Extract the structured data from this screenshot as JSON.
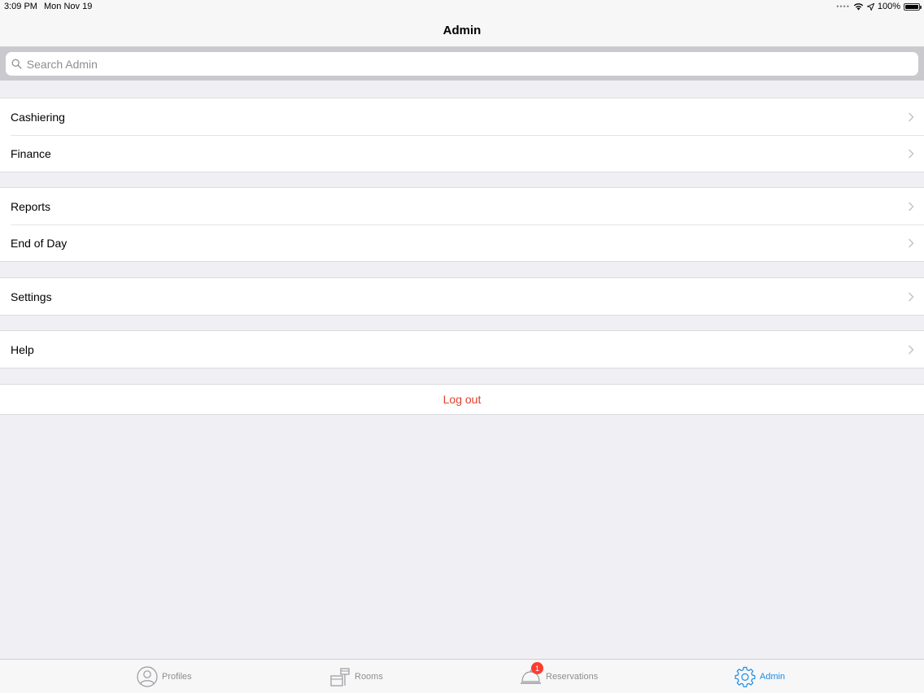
{
  "status_bar": {
    "time": "3:09 PM",
    "date": "Mon Nov 19",
    "battery_text": "100%",
    "icons": [
      "cellular-dots-icon",
      "wifi-icon",
      "location-arrow-icon",
      "battery-icon"
    ]
  },
  "nav": {
    "title": "Admin"
  },
  "search": {
    "placeholder": "Search Admin",
    "value": ""
  },
  "groups": [
    {
      "items": [
        {
          "label": "Cashiering"
        },
        {
          "label": "Finance"
        }
      ]
    },
    {
      "items": [
        {
          "label": "Reports"
        },
        {
          "label": "End of Day"
        }
      ]
    },
    {
      "items": [
        {
          "label": "Settings"
        }
      ]
    },
    {
      "items": [
        {
          "label": "Help"
        }
      ]
    }
  ],
  "logout": {
    "label": "Log out",
    "color": "#e1402a"
  },
  "tabbar": {
    "active_color": "#1a8ce6",
    "inactive_color": "#8e8e93",
    "tabs": [
      {
        "label": "Profiles",
        "icon": "profile-icon",
        "active": false
      },
      {
        "label": "Rooms",
        "icon": "rooms-icon",
        "active": false
      },
      {
        "label": "Reservations",
        "icon": "service-bell-icon",
        "active": false,
        "badge": "1"
      },
      {
        "label": "Admin",
        "icon": "gear-icon",
        "active": true
      }
    ]
  }
}
